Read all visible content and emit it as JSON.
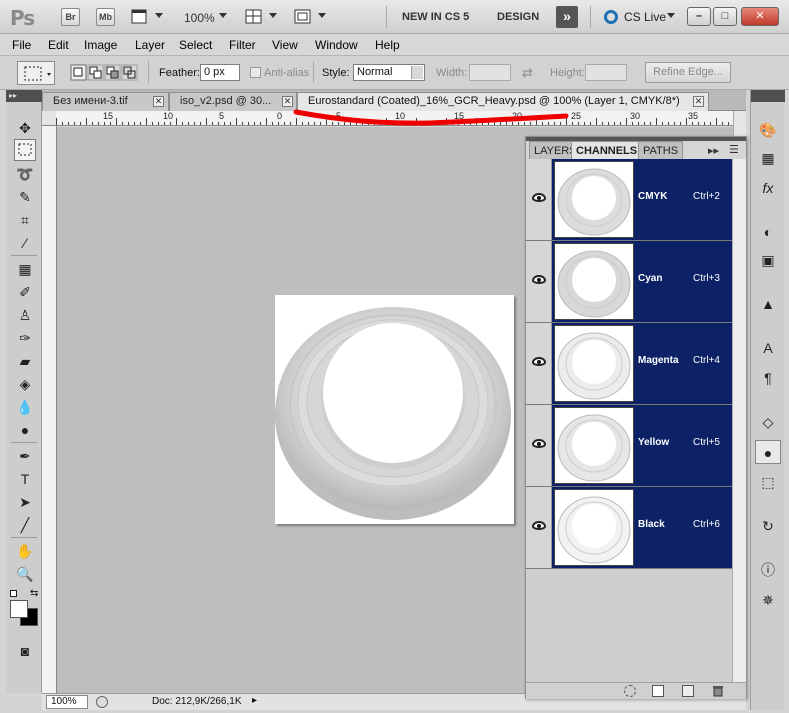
{
  "app_bar": {
    "logo": "Ps",
    "bridge_label": "Br",
    "minibridge_label": "Mb",
    "zoom_level": "100%",
    "workspace_new": "NEW IN CS 5",
    "workspace_design": "DESIGN",
    "more_workspaces_icon": "»",
    "cs_live": "CS Live",
    "minimize_icon": "–",
    "restore_icon": "□",
    "close_icon": "✕"
  },
  "menu": [
    "File",
    "Edit",
    "Image",
    "Layer",
    "Select",
    "Filter",
    "View",
    "Window",
    "Help"
  ],
  "options": {
    "feather_label": "Feather:",
    "feather_value": "0 px",
    "antialias_label": "Anti-alias",
    "style_label": "Style:",
    "style_value": "Normal",
    "width_label": "Width:",
    "height_label": "Height:",
    "refine_edge_label": "Refine Edge..."
  },
  "doc_tabs": [
    {
      "label": "Без имени-3.tif",
      "active": false
    },
    {
      "label": "iso_v2.psd @ 30...",
      "active": false
    },
    {
      "label": "Eurostandard (Coated)_16%_GCR_Heavy.psd @ 100% (Layer 1, CMYK/8*)",
      "active": true
    }
  ],
  "ruler_labels": [
    "15",
    "10",
    "5",
    "0",
    "5",
    "10",
    "15",
    "20",
    "25",
    "30",
    "35"
  ],
  "panel": {
    "tabs": [
      "LAYERS",
      "CHANNELS",
      "PATHS"
    ],
    "active_tab": "CHANNELS",
    "channels": [
      {
        "name": "CMYK",
        "shortcut": "Ctrl+2"
      },
      {
        "name": "Cyan",
        "shortcut": "Ctrl+3"
      },
      {
        "name": "Magenta",
        "shortcut": "Ctrl+4"
      },
      {
        "name": "Yellow",
        "shortcut": "Ctrl+5"
      },
      {
        "name": "Black",
        "shortcut": "Ctrl+6"
      }
    ]
  },
  "status": {
    "zoom": "100%",
    "doc_info": "Doc: 212,9K/266,1K"
  },
  "colors": {
    "channel_highlight": "#0d2266",
    "annotation_red": "#ee0000"
  }
}
